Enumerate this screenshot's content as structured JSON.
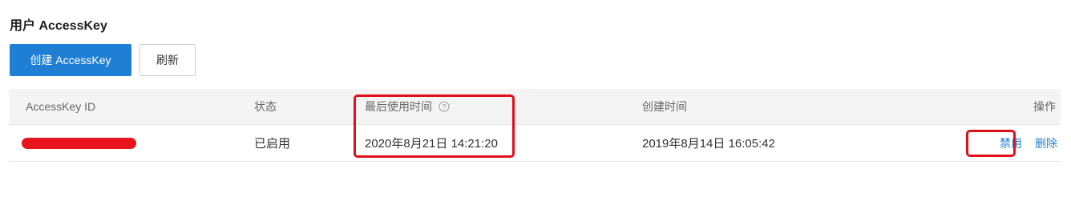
{
  "section": {
    "title": "用户 AccessKey"
  },
  "toolbar": {
    "create_label": "创建 AccessKey",
    "refresh_label": "刷新"
  },
  "table": {
    "columns": [
      "AccessKey ID",
      "状态",
      "最后使用时间",
      "创建时间",
      "操作"
    ],
    "rows": [
      {
        "access_key_id": "",
        "status": "已启用",
        "last_used": "2020年8月21日 14:21:20",
        "created": "2019年8月14日 16:05:42",
        "actions": [
          "禁用",
          "删除"
        ]
      }
    ]
  },
  "icons": {
    "help": "help-circle-icon"
  },
  "colors": {
    "accent": "#1f7fd4",
    "highlight": "#e10f1a",
    "redaction": "#e8141c"
  }
}
